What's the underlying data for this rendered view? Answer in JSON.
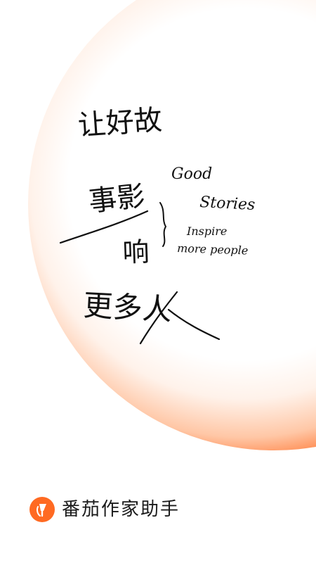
{
  "splash": {
    "slogan_cn_lines": [
      "让好故",
      "事影",
      "响",
      "更多人"
    ],
    "slogan_en": [
      "Good",
      "Stories",
      "Inspire",
      "more people"
    ]
  },
  "brand": {
    "name": "番茄作家助手",
    "logo_icon": "tomato-pen-icon",
    "accent_color": "#ff6a22"
  }
}
